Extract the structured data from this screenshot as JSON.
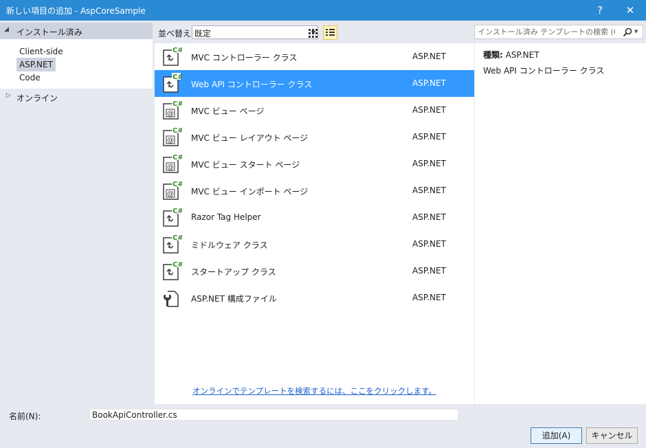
{
  "window": {
    "title": "新しい項目の追加 - AspCoreSample",
    "help_glyph": "?",
    "close_glyph": "✕"
  },
  "sidebar": {
    "installed": "インストール済み",
    "children": [
      "Client-side",
      "ASP.NET",
      "Code"
    ],
    "selected_child": "ASP.NET",
    "online": "オンライン"
  },
  "toolbar": {
    "sort_label": "並べ替え:",
    "sort_value": "既定",
    "view_mode": "list"
  },
  "search": {
    "placeholder": "インストール済み テンプレートの検索 (Ctrl+E)",
    "icon": "search-icon"
  },
  "templates": [
    {
      "name": "MVC コントローラー クラス",
      "category": "ASP.NET",
      "icon": "csharp-class-icon"
    },
    {
      "name": "Web API コントローラー クラス",
      "category": "ASP.NET",
      "icon": "csharp-class-icon",
      "selected": true
    },
    {
      "name": "MVC ビュー ページ",
      "category": "ASP.NET",
      "icon": "razor-page-icon"
    },
    {
      "name": "MVC ビュー レイアウト ページ",
      "category": "ASP.NET",
      "icon": "razor-page-icon"
    },
    {
      "name": "MVC ビュー スタート ページ",
      "category": "ASP.NET",
      "icon": "razor-page-icon"
    },
    {
      "name": "MVC ビュー インポート ページ",
      "category": "ASP.NET",
      "icon": "razor-page-icon"
    },
    {
      "name": "Razor Tag Helper",
      "category": "ASP.NET",
      "icon": "csharp-class-icon"
    },
    {
      "name": "ミドルウェア クラス",
      "category": "ASP.NET",
      "icon": "csharp-class-icon"
    },
    {
      "name": "スタートアップ クラス",
      "category": "ASP.NET",
      "icon": "csharp-class-icon"
    },
    {
      "name": "ASP.NET 構成ファイル",
      "category": "ASP.NET",
      "icon": "config-file-icon"
    }
  ],
  "online_link": "オンラインでテンプレートを検索するには、ここをクリックします。",
  "details": {
    "type_label": "種類:",
    "type_value": "ASP.NET",
    "description": "Web API コントローラー クラス"
  },
  "footer": {
    "name_label": "名前(N):",
    "name_value": "BookApiController.cs",
    "add_label": "追加(A)",
    "cancel_label": "キャンセル"
  },
  "colors": {
    "titlebar": "#2b8ad4",
    "selection": "#3399ff",
    "link": "#1e5ecf",
    "csharp_badge": "#3a8a2e"
  }
}
